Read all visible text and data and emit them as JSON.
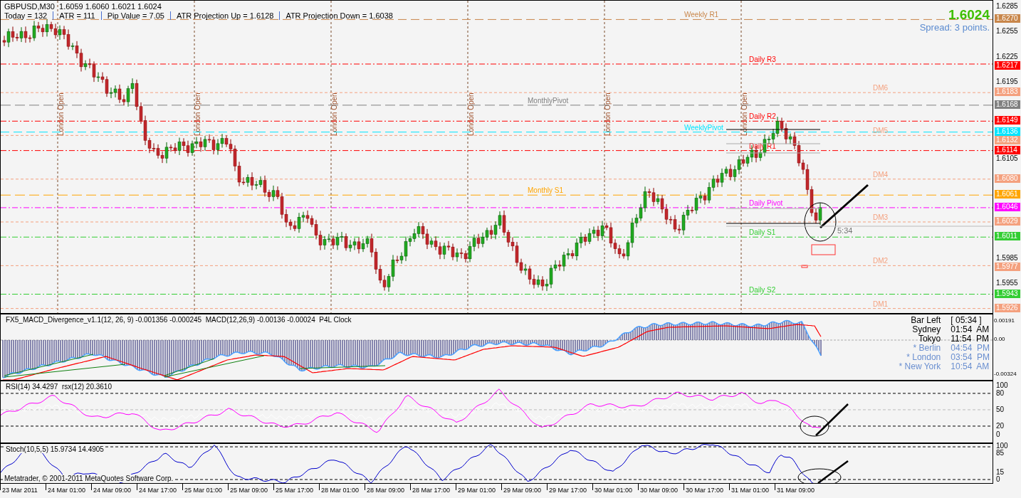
{
  "symbol_line": "GBPUSD,M30  1.6059 1.6060 1.6021 1.6024",
  "header_stats": [
    "Today = 132",
    "ATR = 111",
    "Pip Value = 7.05",
    "ATR Projection Up = 1.6128",
    "ATR Projection Down = 1.6038"
  ],
  "price_display": {
    "price": "1.6024",
    "spread": "Spread: 3 points."
  },
  "session_markers": [
    "London Open",
    "London Open",
    "London Open",
    "London Open",
    "London Open",
    "London Open"
  ],
  "levels": [
    {
      "label": "Weekly R1",
      "price": "1.6270",
      "kind": "weekly",
      "color": "#c8864a"
    },
    {
      "label": "Daily R3",
      "price": "1.6217",
      "kind": "daily",
      "color": "#ff0000"
    },
    {
      "label": "DM6",
      "price": "1.6183",
      "kind": "dm",
      "color": "#f4a07e"
    },
    {
      "label": "MonthlyPivot",
      "price": "1.6168",
      "kind": "monthly",
      "color": "#808080"
    },
    {
      "label": "Daily R2",
      "price": "1.6149",
      "kind": "daily",
      "color": "#ff0000"
    },
    {
      "label": "WeeklyPivot",
      "price": "1.6136",
      "kind": "weekly",
      "color": "#00e5ff"
    },
    {
      "label": "DM5",
      "price": "1.6132",
      "kind": "dm",
      "color": "#f4a07e"
    },
    {
      "label": "Daily R1",
      "price": "1.6114",
      "kind": "daily",
      "color": "#ff0000"
    },
    {
      "label": "DM4",
      "price": "1.6080",
      "kind": "dm",
      "color": "#f4a07e"
    },
    {
      "label": "Monthly S1",
      "price": "1.6061",
      "kind": "monthly",
      "color": "#ffa500"
    },
    {
      "label": "Daily Pivot",
      "price": "1.6046",
      "kind": "daily",
      "color": "#ff00ff"
    },
    {
      "label": "DM3",
      "price": "1.6029",
      "kind": "dm",
      "color": "#f4a07e"
    },
    {
      "label": "Daily S1",
      "price": "1.6011",
      "kind": "daily",
      "color": "#32cd32"
    },
    {
      "label": "DM2",
      "price": "1.5977",
      "kind": "dm",
      "color": "#f4a07e"
    },
    {
      "label": "Daily S2",
      "price": "1.5943",
      "kind": "daily",
      "color": "#32cd32"
    },
    {
      "label": "DM1",
      "price": "1.5926",
      "kind": "dm",
      "color": "#f4a07e"
    }
  ],
  "price_axis": [
    "1.6285",
    "1.6255",
    "1.6225",
    "1.6195",
    "1.6105",
    "1.5985",
    "1.5955"
  ],
  "candle_timer": "5:34",
  "macd_panel": {
    "title": "FX5_MACD_Divergence_v1.1(12, 26, 9) -0.001356 -0.000245  MACD(12,26,9) -0.00136 -0.00024  P4L Clock",
    "axis": [
      "0.00191",
      "0.00",
      "-0.00324"
    ],
    "clock": [
      {
        "label": "Bar Left",
        "time": "[ 05:34 ]",
        "starred": false
      },
      {
        "label": "Sydney",
        "time": "01:54  AM",
        "starred": false
      },
      {
        "label": "Tokyo",
        "time": "11:54  PM",
        "starred": false
      },
      {
        "label": "* Berlin",
        "time": "04:54  PM",
        "starred": true
      },
      {
        "label": "* London",
        "time": "03:54  PM",
        "starred": true
      },
      {
        "label": "* New York",
        "time": "10:54  AM",
        "starred": true
      }
    ]
  },
  "rsi_panel": {
    "title": "RSI(14) 34.4297  rsx(12) 20.3610",
    "axis": [
      "100",
      "80",
      "50",
      "20",
      "0"
    ]
  },
  "stoch_panel": {
    "title": "Stoch(10,5,5) 15.9734 14.4905",
    "axis": [
      "100",
      "85",
      "15",
      "0"
    ]
  },
  "copyright": "Metatrader, © 2001-2011 MetaQuotes Software Corp.",
  "time_axis": [
    "23 Mar 2011",
    "24 Mar 01:00",
    "24 Mar 09:00",
    "24 Mar 17:00",
    "25 Mar 01:00",
    "25 Mar 09:00",
    "25 Mar 17:00",
    "28 Mar 01:00",
    "28 Mar 09:00",
    "28 Mar 17:00",
    "29 Mar 01:00",
    "29 Mar 09:00",
    "29 Mar 17:00",
    "30 Mar 01:00",
    "30 Mar 09:00",
    "30 Mar 17:00",
    "31 Mar 01:00",
    "31 Mar 09:00"
  ]
}
